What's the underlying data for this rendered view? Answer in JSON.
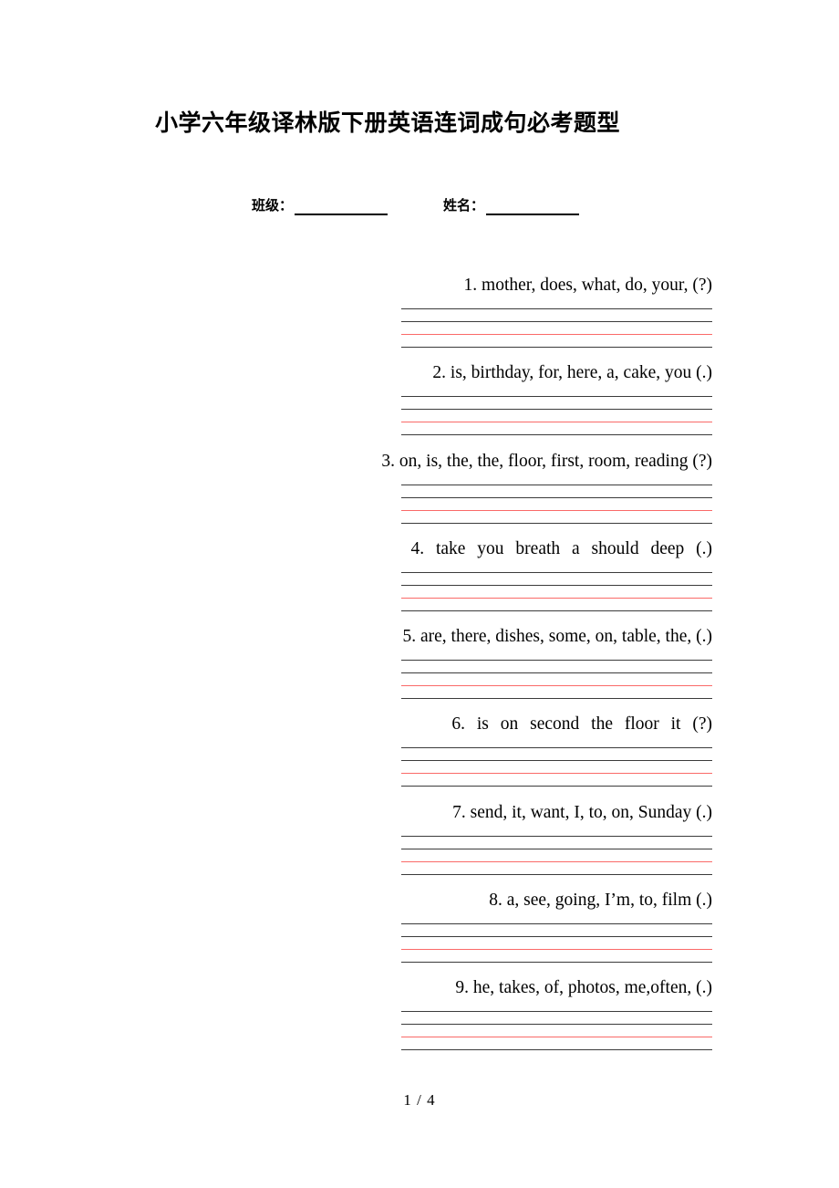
{
  "document": {
    "title": "小学六年级译林版下册英语连词成句必考题型",
    "page_number": "1 / 4"
  },
  "meta": {
    "class_label": "班级：",
    "name_label": "姓名："
  },
  "ruler": {
    "line_color": "#3b3b3b",
    "red_line_color": "#fa6a68",
    "lines": 4
  },
  "exercises": [
    {
      "text": "1. mother, does, what, do, your, (?)",
      "spaced": false
    },
    {
      "text": "2. is, birthday, for, here, a, cake, you (.)",
      "spaced": false
    },
    {
      "text": "3. on, is, the, the, floor, first, room, reading (?)",
      "spaced": false
    },
    {
      "text": "4. take you breath a should deep (.)",
      "spaced": true
    },
    {
      "text": "5. are, there, dishes, some, on, table, the, (.)",
      "spaced": false
    },
    {
      "text": "6. is on second the floor it (?)",
      "spaced": true
    },
    {
      "text": "7. send, it, want, I, to, on, Sunday (.)",
      "spaced": false
    },
    {
      "text": "8. a, see, going, I’m, to, film (.)",
      "spaced": false
    },
    {
      "text": "9. he, takes, of, photos, me,often, (.)",
      "spaced": false
    }
  ]
}
